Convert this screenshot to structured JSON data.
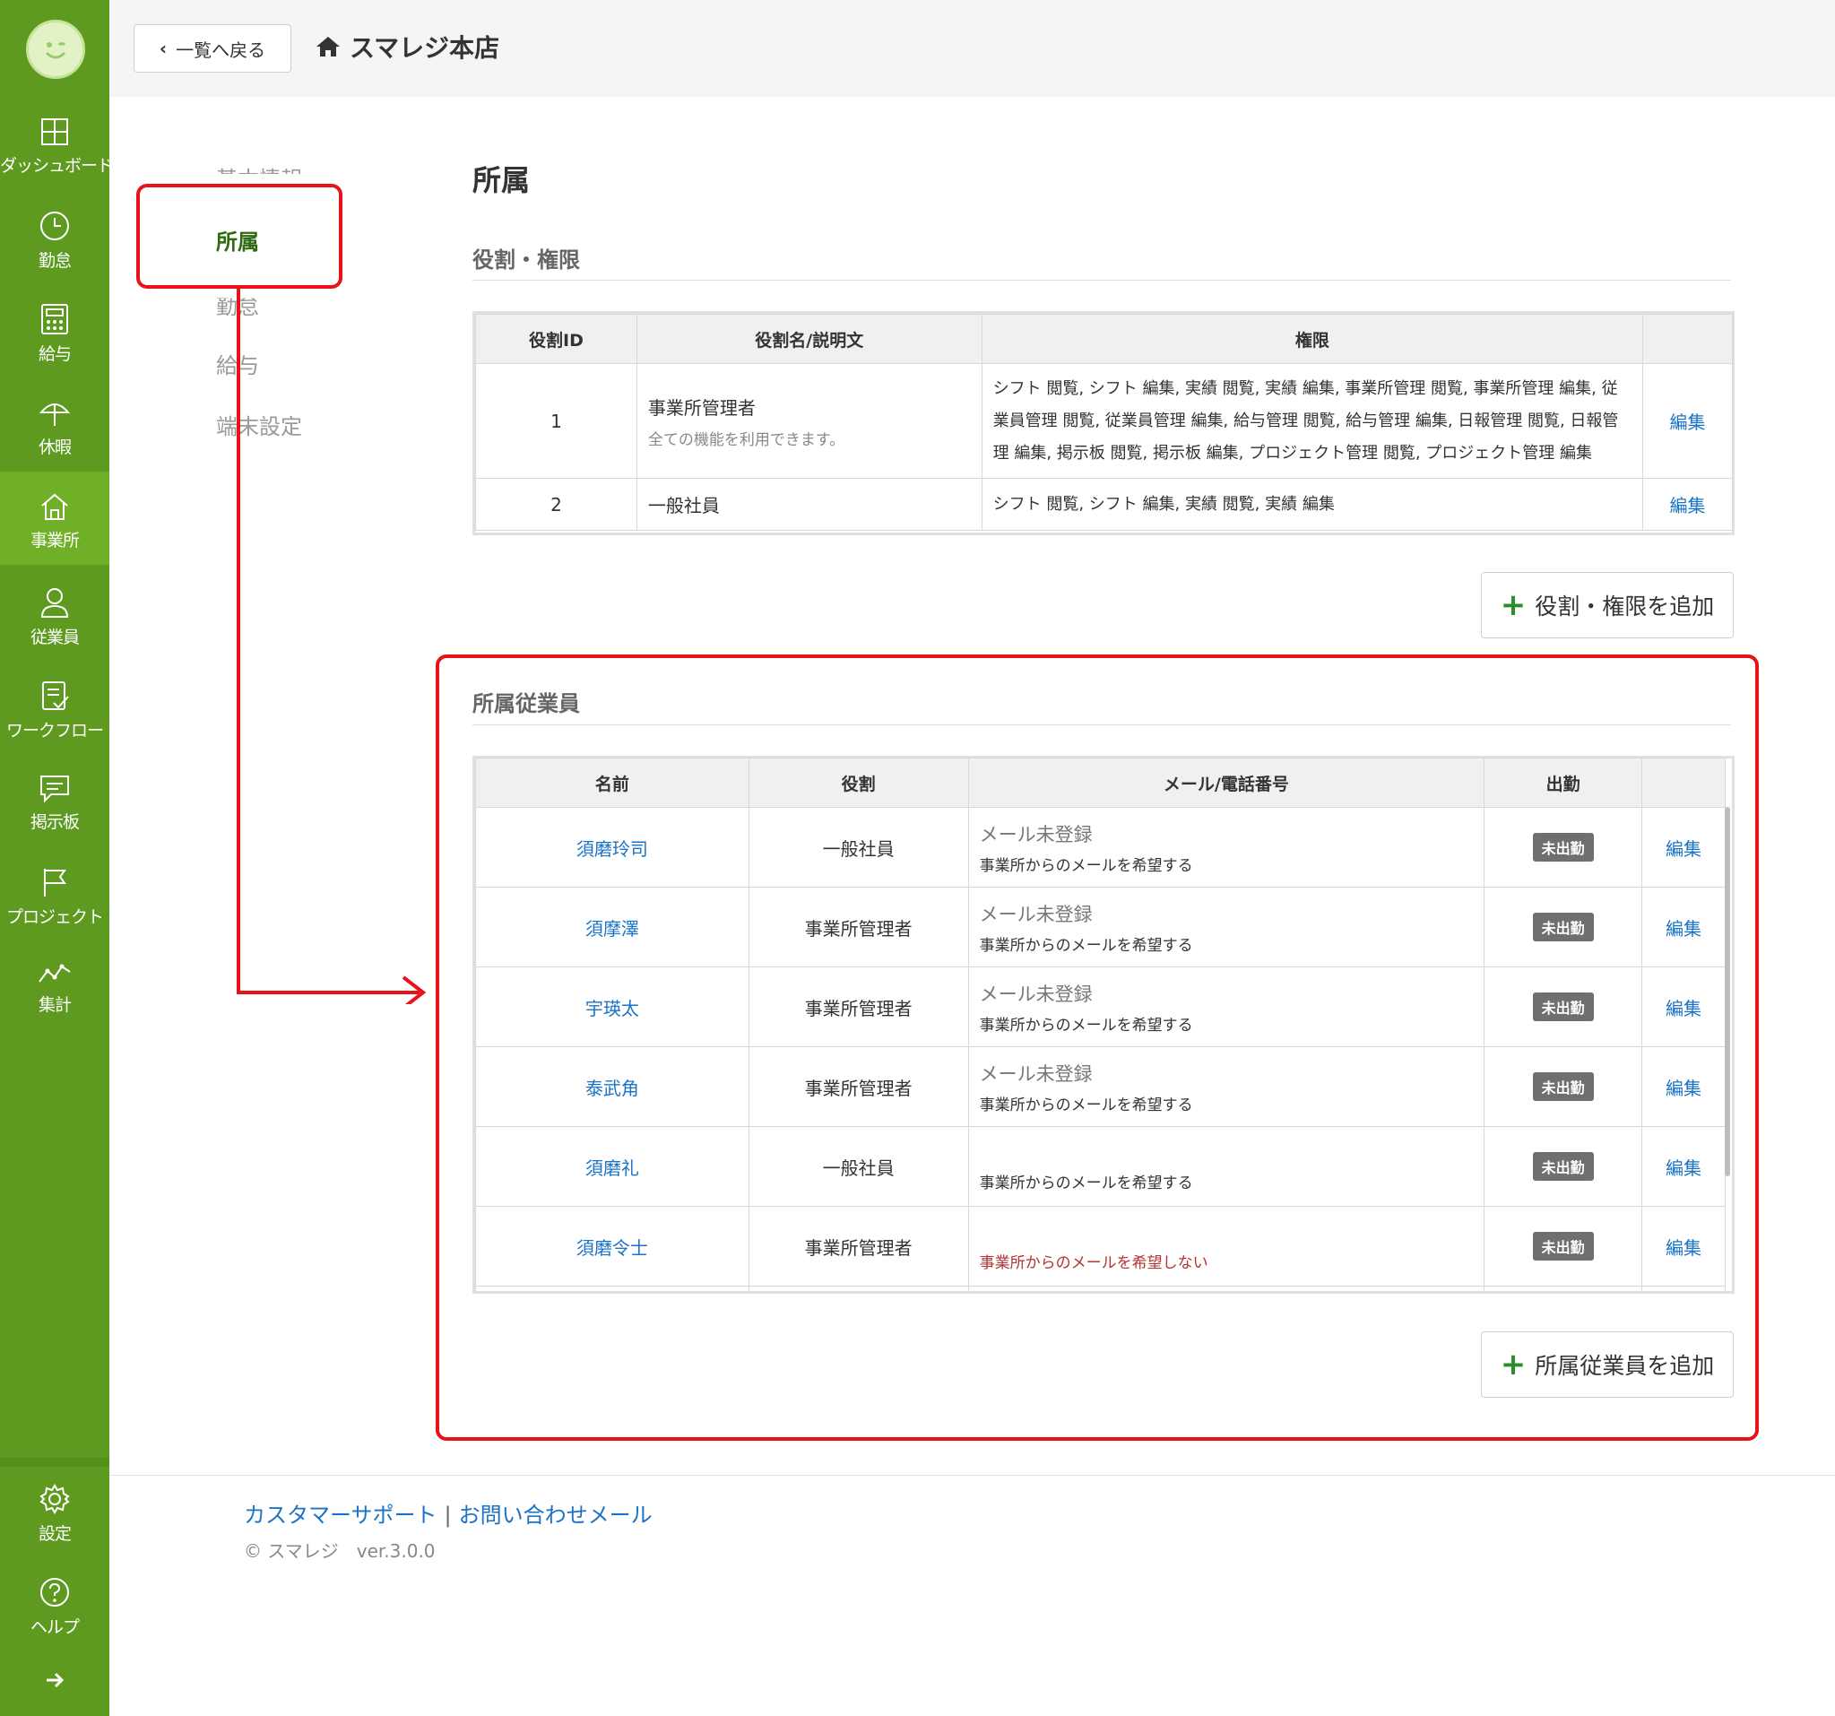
{
  "sidebar": {
    "items": [
      {
        "label": "ダッシュボード",
        "icon": "dashboard-icon"
      },
      {
        "label": "勤怠",
        "icon": "clock-icon"
      },
      {
        "label": "給与",
        "icon": "calculator-icon"
      },
      {
        "label": "休暇",
        "icon": "umbrella-icon"
      },
      {
        "label": "事業所",
        "icon": "home-icon"
      },
      {
        "label": "従業員",
        "icon": "person-icon"
      },
      {
        "label": "ワークフロー",
        "icon": "checklist-icon"
      },
      {
        "label": "掲示板",
        "icon": "message-icon"
      },
      {
        "label": "プロジェクト",
        "icon": "flag-icon"
      },
      {
        "label": "集計",
        "icon": "chart-icon"
      },
      {
        "label": "設定",
        "icon": "gear-icon"
      },
      {
        "label": "ヘルプ",
        "icon": "help-icon"
      }
    ]
  },
  "topbar": {
    "back_label": "一覧へ戻る",
    "store_name": "スマレジ本店"
  },
  "subnav": {
    "items": [
      "基本情報",
      "所属",
      "勤怠",
      "給与",
      "端末設定"
    ]
  },
  "main": {
    "title": "所属",
    "roles_heading": "役割・権限",
    "roles_table": {
      "headers": [
        "役割ID",
        "役割名/説明文",
        "権限",
        ""
      ],
      "rows": [
        {
          "id": "1",
          "name": "事業所管理者",
          "desc": "全ての機能を利用できます。",
          "perms": "シフト 閲覧, シフト 編集, 実績 閲覧, 実績 編集, 事業所管理 閲覧, 事業所管理 編集, 従業員管理 閲覧, 従業員管理 編集, 給与管理 閲覧, 給与管理 編集, 日報管理 閲覧, 日報管理 編集, 掲示板 閲覧, 掲示板 編集, プロジェクト管理 閲覧, プロジェクト管理 編集",
          "edit": "編集"
        },
        {
          "id": "2",
          "name": "一般社員",
          "desc": "",
          "perms": "シフト 閲覧, シフト 編集, 実績 閲覧, 実績 編集",
          "edit": "編集"
        }
      ]
    },
    "add_role_label": "役割・権限を追加",
    "employees_heading": "所属従業員",
    "employees_table": {
      "headers": [
        "名前",
        "役割",
        "メール/電話番号",
        "出勤",
        ""
      ],
      "rows": [
        {
          "name": "須磨玲司",
          "role": "一般社員",
          "mail": "メール未登録",
          "pref": "事業所からのメールを希望する",
          "status": "未出勤",
          "edit": "編集"
        },
        {
          "name": "須摩澤",
          "role": "事業所管理者",
          "mail": "メール未登録",
          "pref": "事業所からのメールを希望する",
          "status": "未出勤",
          "edit": "編集"
        },
        {
          "name": "宇瑛太",
          "role": "事業所管理者",
          "mail": "メール未登録",
          "pref": "事業所からのメールを希望する",
          "status": "未出勤",
          "edit": "編集"
        },
        {
          "name": "泰武角",
          "role": "事業所管理者",
          "mail": "メール未登録",
          "pref": "事業所からのメールを希望する",
          "status": "未出勤",
          "edit": "編集"
        },
        {
          "name": "須磨礼",
          "role": "一般社員",
          "mail": "",
          "pref": "事業所からのメールを希望する",
          "status": "未出勤",
          "edit": "編集"
        },
        {
          "name": "須磨令士",
          "role": "事業所管理者",
          "mail": "",
          "pref": "事業所からのメールを希望しない",
          "status": "未出勤",
          "edit": "編集"
        }
      ]
    },
    "add_employee_label": "所属従業員を追加"
  },
  "footer": {
    "support_link": "カスタマーサポート",
    "separator": "|",
    "contact_link": "お問い合わせメール",
    "copyright": "© スマレジ　ver.3.0.0"
  },
  "colors": {
    "sidebar": "#5d9a1f",
    "accent_link": "#1a73c6",
    "highlight": "#e8121b"
  }
}
